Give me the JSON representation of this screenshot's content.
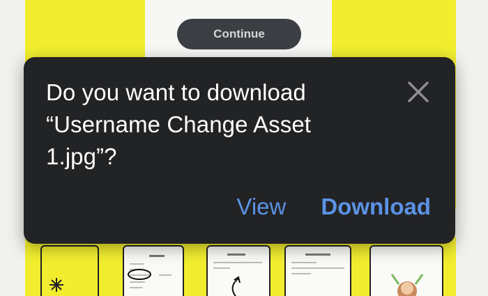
{
  "background": {
    "continue_label": "Continue"
  },
  "dialog": {
    "message_line1": "Do you want to download",
    "message_line2": "“Username Change Asset",
    "message_line3": "1.jpg”?",
    "close_icon": "close-icon",
    "view_label": "View",
    "download_label": "Download",
    "accent_color": "#5b92e5",
    "background_color": "#222325"
  }
}
